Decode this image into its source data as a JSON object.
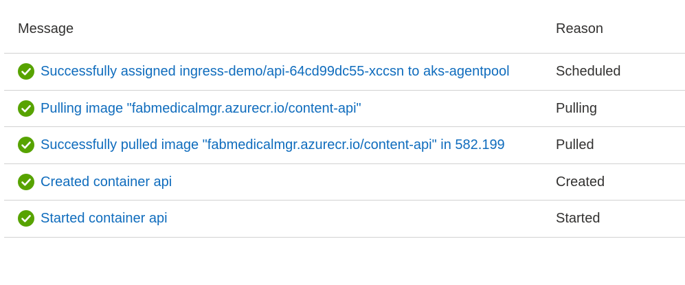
{
  "table": {
    "headers": {
      "message": "Message",
      "reason": "Reason"
    },
    "rows": [
      {
        "status_icon": "success-check-icon",
        "message": "Successfully assigned ingress-demo/api-64cd99dc55-xccsn to aks-agentpool",
        "reason": "Scheduled"
      },
      {
        "status_icon": "success-check-icon",
        "message": "Pulling image \"fabmedicalmgr.azurecr.io/content-api\"",
        "reason": "Pulling"
      },
      {
        "status_icon": "success-check-icon",
        "message": "Successfully pulled image \"fabmedicalmgr.azurecr.io/content-api\" in 582.199",
        "reason": "Pulled"
      },
      {
        "status_icon": "success-check-icon",
        "message": "Created container api",
        "reason": "Created"
      },
      {
        "status_icon": "success-check-icon",
        "message": "Started container api",
        "reason": "Started"
      }
    ]
  },
  "colors": {
    "success": "#57a300",
    "link": "#0f6cbd",
    "text": "#323130",
    "divider": "#d1d1d1"
  }
}
